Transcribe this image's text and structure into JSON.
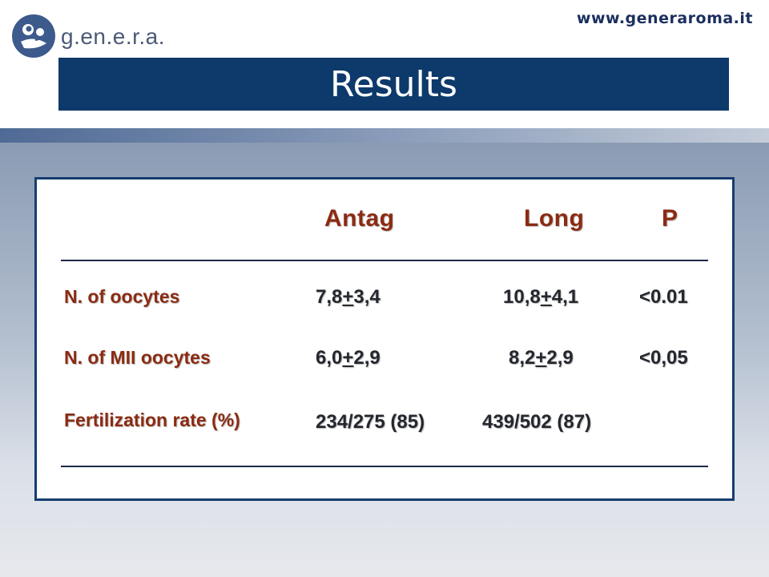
{
  "header": {
    "logo_text": "g.en.e.r.a.",
    "website": "www.generaroma.it",
    "title": "Results"
  },
  "table": {
    "columns": [
      "Antag",
      "Long",
      "P"
    ],
    "rows": [
      {
        "label": "N. of oocytes",
        "antag": {
          "a": "7,8",
          "pm": "+",
          "b": "3,4"
        },
        "long": {
          "a": "10,8",
          "pm": "+",
          "b": "4,1"
        },
        "p": "<0.01"
      },
      {
        "label": "N. of MII oocytes",
        "antag": {
          "a": "6,0",
          "pm": "+",
          "b": "2,9"
        },
        "long": {
          "a": "8,2",
          "pm": "+",
          "b": "2,9"
        },
        "p": "<0,05"
      },
      {
        "label": "Fertilization rate (%)",
        "antag_text": "234/275 (85)",
        "long_text": "439/502 (87)",
        "p": ""
      }
    ]
  },
  "colors": {
    "title_bar": "#0d3a6b",
    "label_red": "#8b2b12",
    "table_border": "#163d6e"
  }
}
